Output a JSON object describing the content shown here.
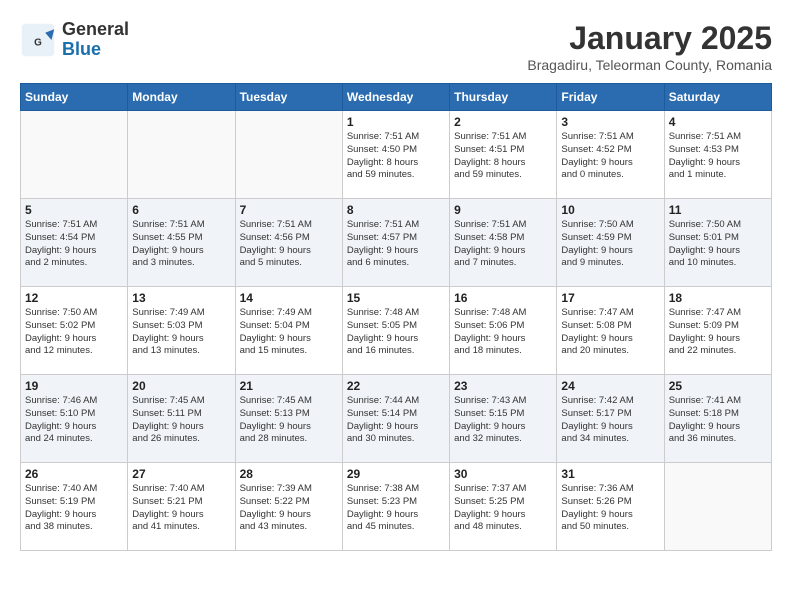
{
  "header": {
    "logo_general": "General",
    "logo_blue": "Blue",
    "month_title": "January 2025",
    "subtitle": "Bragadiru, Teleorman County, Romania"
  },
  "weekdays": [
    "Sunday",
    "Monday",
    "Tuesday",
    "Wednesday",
    "Thursday",
    "Friday",
    "Saturday"
  ],
  "weeks": [
    [
      {
        "day": "",
        "info": ""
      },
      {
        "day": "",
        "info": ""
      },
      {
        "day": "",
        "info": ""
      },
      {
        "day": "1",
        "info": "Sunrise: 7:51 AM\nSunset: 4:50 PM\nDaylight: 8 hours\nand 59 minutes."
      },
      {
        "day": "2",
        "info": "Sunrise: 7:51 AM\nSunset: 4:51 PM\nDaylight: 8 hours\nand 59 minutes."
      },
      {
        "day": "3",
        "info": "Sunrise: 7:51 AM\nSunset: 4:52 PM\nDaylight: 9 hours\nand 0 minutes."
      },
      {
        "day": "4",
        "info": "Sunrise: 7:51 AM\nSunset: 4:53 PM\nDaylight: 9 hours\nand 1 minute."
      }
    ],
    [
      {
        "day": "5",
        "info": "Sunrise: 7:51 AM\nSunset: 4:54 PM\nDaylight: 9 hours\nand 2 minutes."
      },
      {
        "day": "6",
        "info": "Sunrise: 7:51 AM\nSunset: 4:55 PM\nDaylight: 9 hours\nand 3 minutes."
      },
      {
        "day": "7",
        "info": "Sunrise: 7:51 AM\nSunset: 4:56 PM\nDaylight: 9 hours\nand 5 minutes."
      },
      {
        "day": "8",
        "info": "Sunrise: 7:51 AM\nSunset: 4:57 PM\nDaylight: 9 hours\nand 6 minutes."
      },
      {
        "day": "9",
        "info": "Sunrise: 7:51 AM\nSunset: 4:58 PM\nDaylight: 9 hours\nand 7 minutes."
      },
      {
        "day": "10",
        "info": "Sunrise: 7:50 AM\nSunset: 4:59 PM\nDaylight: 9 hours\nand 9 minutes."
      },
      {
        "day": "11",
        "info": "Sunrise: 7:50 AM\nSunset: 5:01 PM\nDaylight: 9 hours\nand 10 minutes."
      }
    ],
    [
      {
        "day": "12",
        "info": "Sunrise: 7:50 AM\nSunset: 5:02 PM\nDaylight: 9 hours\nand 12 minutes."
      },
      {
        "day": "13",
        "info": "Sunrise: 7:49 AM\nSunset: 5:03 PM\nDaylight: 9 hours\nand 13 minutes."
      },
      {
        "day": "14",
        "info": "Sunrise: 7:49 AM\nSunset: 5:04 PM\nDaylight: 9 hours\nand 15 minutes."
      },
      {
        "day": "15",
        "info": "Sunrise: 7:48 AM\nSunset: 5:05 PM\nDaylight: 9 hours\nand 16 minutes."
      },
      {
        "day": "16",
        "info": "Sunrise: 7:48 AM\nSunset: 5:06 PM\nDaylight: 9 hours\nand 18 minutes."
      },
      {
        "day": "17",
        "info": "Sunrise: 7:47 AM\nSunset: 5:08 PM\nDaylight: 9 hours\nand 20 minutes."
      },
      {
        "day": "18",
        "info": "Sunrise: 7:47 AM\nSunset: 5:09 PM\nDaylight: 9 hours\nand 22 minutes."
      }
    ],
    [
      {
        "day": "19",
        "info": "Sunrise: 7:46 AM\nSunset: 5:10 PM\nDaylight: 9 hours\nand 24 minutes."
      },
      {
        "day": "20",
        "info": "Sunrise: 7:45 AM\nSunset: 5:11 PM\nDaylight: 9 hours\nand 26 minutes."
      },
      {
        "day": "21",
        "info": "Sunrise: 7:45 AM\nSunset: 5:13 PM\nDaylight: 9 hours\nand 28 minutes."
      },
      {
        "day": "22",
        "info": "Sunrise: 7:44 AM\nSunset: 5:14 PM\nDaylight: 9 hours\nand 30 minutes."
      },
      {
        "day": "23",
        "info": "Sunrise: 7:43 AM\nSunset: 5:15 PM\nDaylight: 9 hours\nand 32 minutes."
      },
      {
        "day": "24",
        "info": "Sunrise: 7:42 AM\nSunset: 5:17 PM\nDaylight: 9 hours\nand 34 minutes."
      },
      {
        "day": "25",
        "info": "Sunrise: 7:41 AM\nSunset: 5:18 PM\nDaylight: 9 hours\nand 36 minutes."
      }
    ],
    [
      {
        "day": "26",
        "info": "Sunrise: 7:40 AM\nSunset: 5:19 PM\nDaylight: 9 hours\nand 38 minutes."
      },
      {
        "day": "27",
        "info": "Sunrise: 7:40 AM\nSunset: 5:21 PM\nDaylight: 9 hours\nand 41 minutes."
      },
      {
        "day": "28",
        "info": "Sunrise: 7:39 AM\nSunset: 5:22 PM\nDaylight: 9 hours\nand 43 minutes."
      },
      {
        "day": "29",
        "info": "Sunrise: 7:38 AM\nSunset: 5:23 PM\nDaylight: 9 hours\nand 45 minutes."
      },
      {
        "day": "30",
        "info": "Sunrise: 7:37 AM\nSunset: 5:25 PM\nDaylight: 9 hours\nand 48 minutes."
      },
      {
        "day": "31",
        "info": "Sunrise: 7:36 AM\nSunset: 5:26 PM\nDaylight: 9 hours\nand 50 minutes."
      },
      {
        "day": "",
        "info": ""
      }
    ]
  ]
}
